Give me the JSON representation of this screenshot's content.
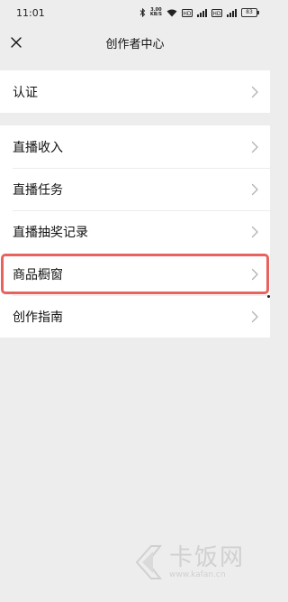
{
  "status_bar": {
    "time": "11:01",
    "speed_value": "3.00",
    "speed_unit": "KB/S",
    "battery": "83"
  },
  "nav": {
    "title": "创作者中心"
  },
  "groups": [
    {
      "items": [
        {
          "label": "认证"
        }
      ]
    },
    {
      "items": [
        {
          "label": "直播收入"
        },
        {
          "label": "直播任务"
        },
        {
          "label": "直播抽奖记录"
        },
        {
          "label": "商品橱窗",
          "highlighted": true
        },
        {
          "label": "创作指南"
        }
      ]
    }
  ],
  "watermark": {
    "name": "卡饭网",
    "url": "www.kafan.cn"
  },
  "colors": {
    "background": "#ededed",
    "highlight": "#e8625e"
  }
}
